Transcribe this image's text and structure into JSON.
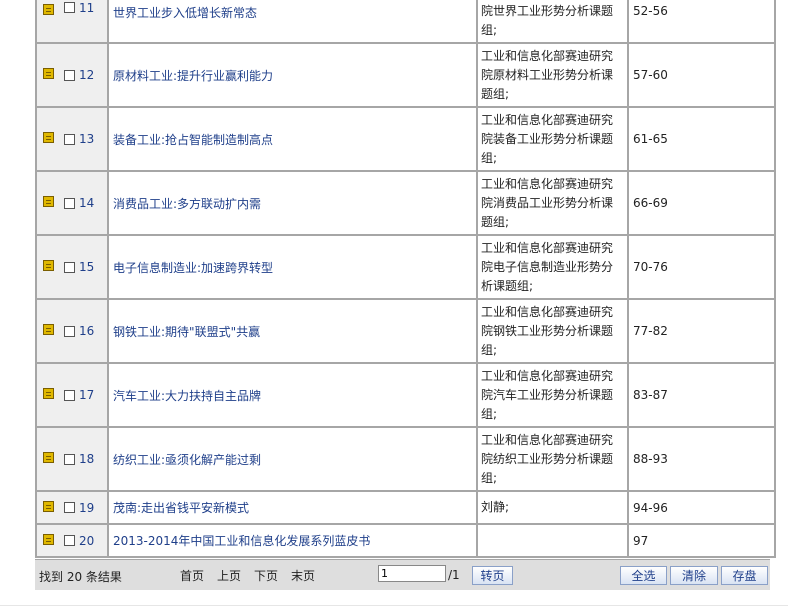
{
  "rows": [
    {
      "num": "11",
      "title": "世界工业步入低增长新常态",
      "author": "院世界工业形势分析课题组;",
      "pages": "52-56"
    },
    {
      "num": "12",
      "title": "原材料工业:提升行业赢利能力",
      "author": "工业和信息化部赛迪研究院原材料工业形势分析课题组;",
      "pages": "57-60"
    },
    {
      "num": "13",
      "title": "装备工业:抢占智能制造制高点",
      "author": "工业和信息化部赛迪研究院装备工业形势分析课题组;",
      "pages": "61-65"
    },
    {
      "num": "14",
      "title": "消费品工业:多方联动扩内需",
      "author": "工业和信息化部赛迪研究院消费品工业形势分析课题组;",
      "pages": "66-69"
    },
    {
      "num": "15",
      "title": "电子信息制造业:加速跨界转型",
      "author": "工业和信息化部赛迪研究院电子信息制造业形势分析课题组;",
      "pages": "70-76"
    },
    {
      "num": "16",
      "title": "钢铁工业:期待\"联盟式\"共赢",
      "author": "工业和信息化部赛迪研究院钢铁工业形势分析课题组;",
      "pages": "77-82"
    },
    {
      "num": "17",
      "title": "汽车工业:大力扶持自主品牌",
      "author": "工业和信息化部赛迪研究院汽车工业形势分析课题组;",
      "pages": "83-87"
    },
    {
      "num": "18",
      "title": "纺织工业:亟须化解产能过剩",
      "author": "工业和信息化部赛迪研究院纺织工业形势分析课题组;",
      "pages": "88-93"
    },
    {
      "num": "19",
      "title": "茂南:走出省钱平安新模式",
      "author": "刘静;",
      "pages": "94-96"
    },
    {
      "num": "20",
      "title": "2013-2014年中国工业和信息化发展系列蓝皮书",
      "author": "",
      "pages": "97"
    }
  ],
  "footer": {
    "found_text": "找到 20 条结果",
    "first": "首页",
    "prev": "上页",
    "next": "下页",
    "last": "末页",
    "page_value": "1",
    "total": "/1",
    "go": "转页",
    "select_all": "全选",
    "clear": "清除",
    "save": "存盘"
  },
  "colors": {
    "link": "#1f3f8a",
    "border": "#a6a6a6",
    "footer_bg": "#dedede",
    "icon": "#e0b800"
  }
}
